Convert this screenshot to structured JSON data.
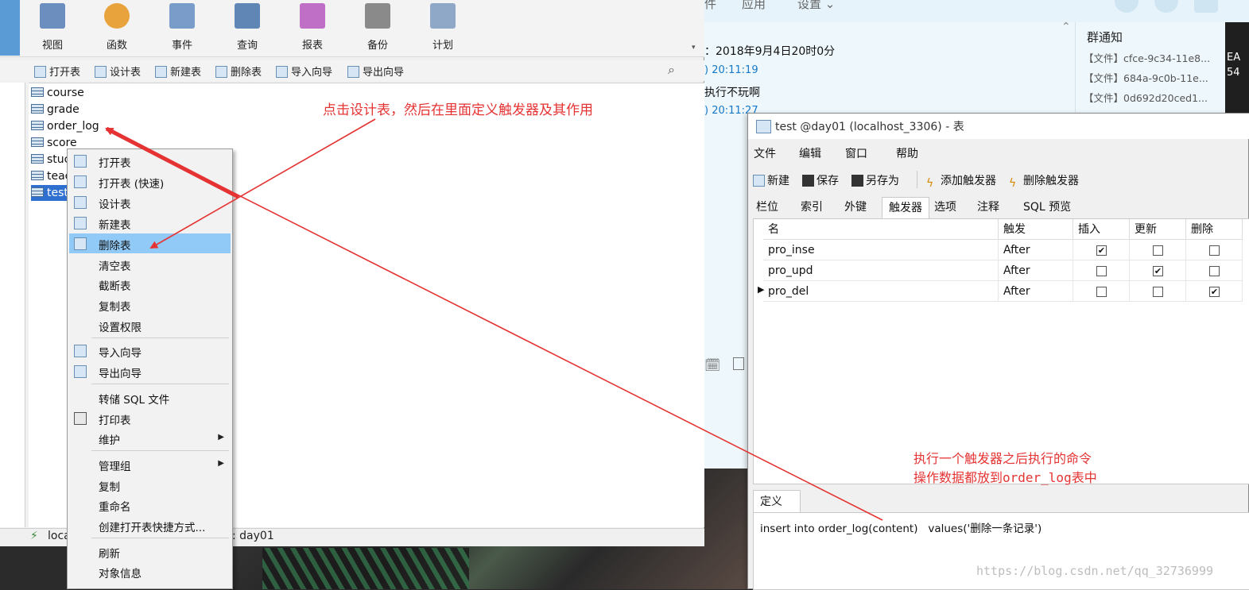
{
  "chat": {
    "menu": [
      "件",
      "应用",
      "设置 ⌄"
    ],
    "date_line": "：2018年9月4日20时0分",
    "time1": ") 20:11:19",
    "msg1": "执行不玩啊",
    "time2": ") 20:11:27",
    "notice_title": "群通知",
    "files": [
      "【文件】cfce-9c34-11e8...",
      "【文件】684a-9c0b-11e...",
      "【文件】0d692d20ced1..."
    ],
    "edge_text": [
      "EA",
      "54"
    ]
  },
  "ribbon": {
    "buttons": [
      {
        "label": "视图",
        "color": "#6c8ebf"
      },
      {
        "label": "函数",
        "color": "#e8a33c"
      },
      {
        "label": "事件",
        "color": "#7a9cc8"
      },
      {
        "label": "查询",
        "color": "#5f86b5"
      },
      {
        "label": "报表",
        "color": "#c06fc6"
      },
      {
        "label": "备份",
        "color": "#8a8a8a"
      },
      {
        "label": "计划",
        "color": "#8fa8c8"
      }
    ]
  },
  "toolbar": {
    "items": [
      "打开表",
      "设计表",
      "新建表",
      "删除表",
      "导入向导",
      "导出向导"
    ]
  },
  "objects": [
    "course",
    "grade",
    "order_log",
    "score",
    "stuc",
    "teac",
    "test"
  ],
  "status": {
    "left": "loca",
    "db": ": day01"
  },
  "context_menu": {
    "items": [
      "打开表",
      "打开表 (快速)",
      "设计表",
      "新建表",
      "删除表",
      "清空表",
      "截断表",
      "复制表",
      "设置权限",
      "导入向导",
      "导出向导",
      "转储 SQL 文件",
      "打印表",
      "维护",
      "管理组",
      "复制",
      "重命名",
      "创建打开表快捷方式...",
      "刷新",
      "对象信息"
    ]
  },
  "dialog": {
    "title": "test @day01 (localhost_3306) - 表",
    "menu": [
      "文件",
      "编辑",
      "窗口",
      "帮助"
    ],
    "tools": [
      "新建",
      "保存",
      "另存为",
      "添加触发器",
      "删除触发器"
    ],
    "tabs": [
      "栏位",
      "索引",
      "外键",
      "触发器",
      "选项",
      "注释",
      "SQL 预览"
    ],
    "columns": [
      "名",
      "触发",
      "插入",
      "更新",
      "删除"
    ],
    "rows": [
      {
        "name": "pro_inse",
        "fire": "After",
        "insert": true,
        "update": false,
        "delete": false
      },
      {
        "name": "pro_upd",
        "fire": "After",
        "insert": false,
        "update": true,
        "delete": false
      },
      {
        "name": "pro_del",
        "fire": "After",
        "insert": false,
        "update": false,
        "delete": true
      }
    ],
    "def_tab": "定义",
    "definition": "insert into order_log(content)   values('删除一条记录')"
  },
  "annotations": {
    "top": "点击设计表，然后在里面定义触发器及其作用",
    "bottom1": "执行一个触发器之后执行的命令",
    "bottom2": "操作数据都放到order_log表中",
    "color": "#e53333"
  },
  "watermark": "https://blog.csdn.net/qq_32736999"
}
